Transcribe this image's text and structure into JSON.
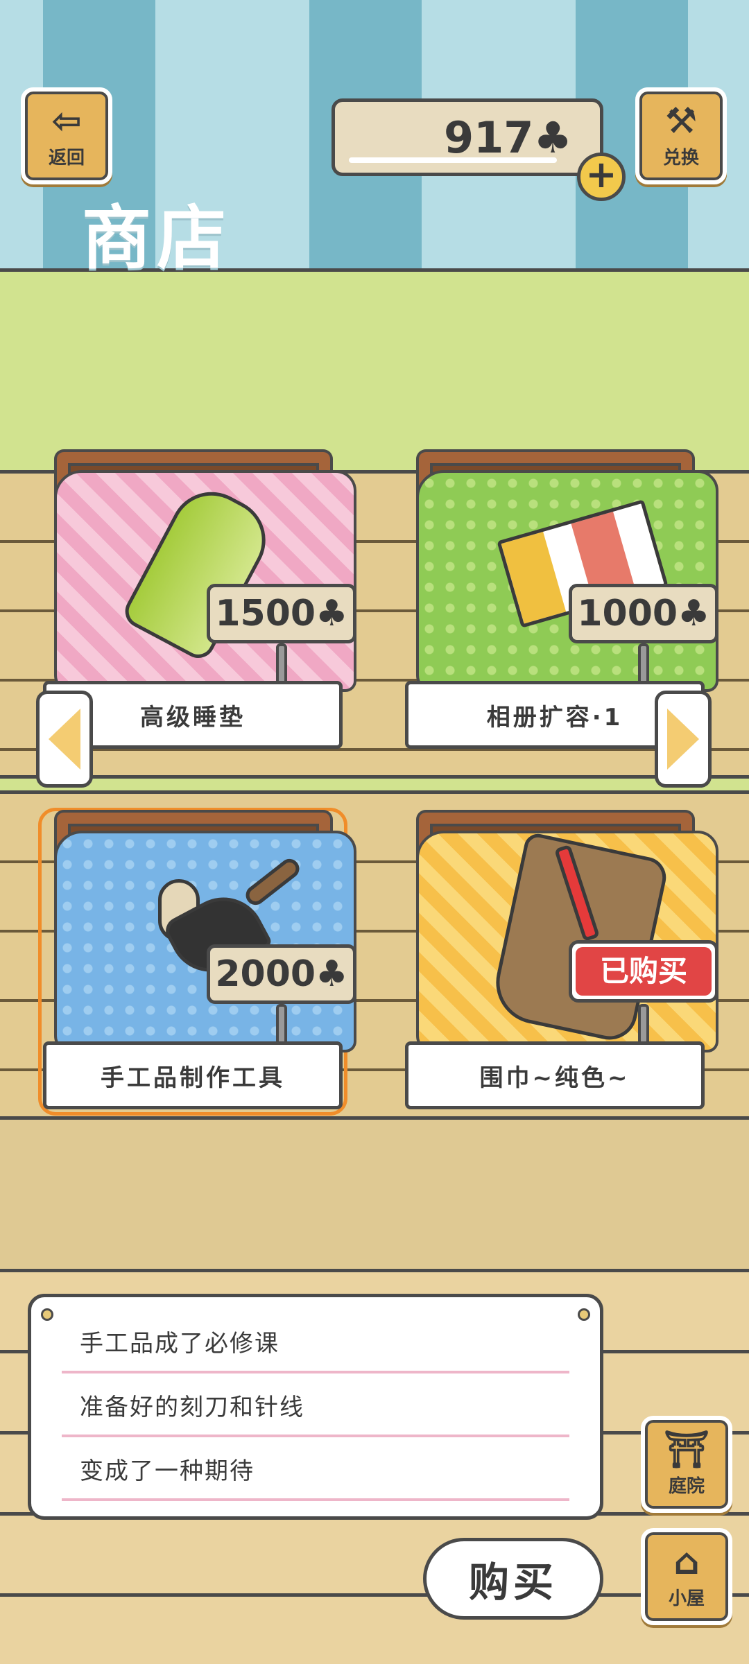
{
  "header": {
    "back_label": "返回",
    "exchange_label": "兑换",
    "balance": "917♣",
    "add_label": "+",
    "title": "商店"
  },
  "items": [
    {
      "name": "高级睡垫",
      "price": "1500♣",
      "status": ""
    },
    {
      "name": "相册扩容·1",
      "price": "1000♣",
      "status": ""
    },
    {
      "name": "手工品制作工具",
      "price": "2000♣",
      "status": ""
    },
    {
      "name": "围巾~纯色~",
      "price": "",
      "status": "已购买"
    }
  ],
  "description": {
    "lines": [
      "手工品成了必修课",
      "准备好的刻刀和针线",
      "变成了一种期待"
    ]
  },
  "actions": {
    "buy_label": "购买",
    "yard_label": "庭院",
    "house_label": "小屋"
  },
  "colors": {
    "wall_light": "#b6dde5",
    "wall_dark": "#77b7c7",
    "grass": "#d1e38f",
    "wood": "#e3cb91",
    "button_orange": "#e6b55c",
    "bought_red": "#e14545",
    "selection": "#f08d2a"
  },
  "icons": {
    "back": "arrow-left-icon",
    "exchange": "hammer-icon",
    "currency": "clover-icon",
    "yard": "yard-icon",
    "house": "house-icon"
  }
}
